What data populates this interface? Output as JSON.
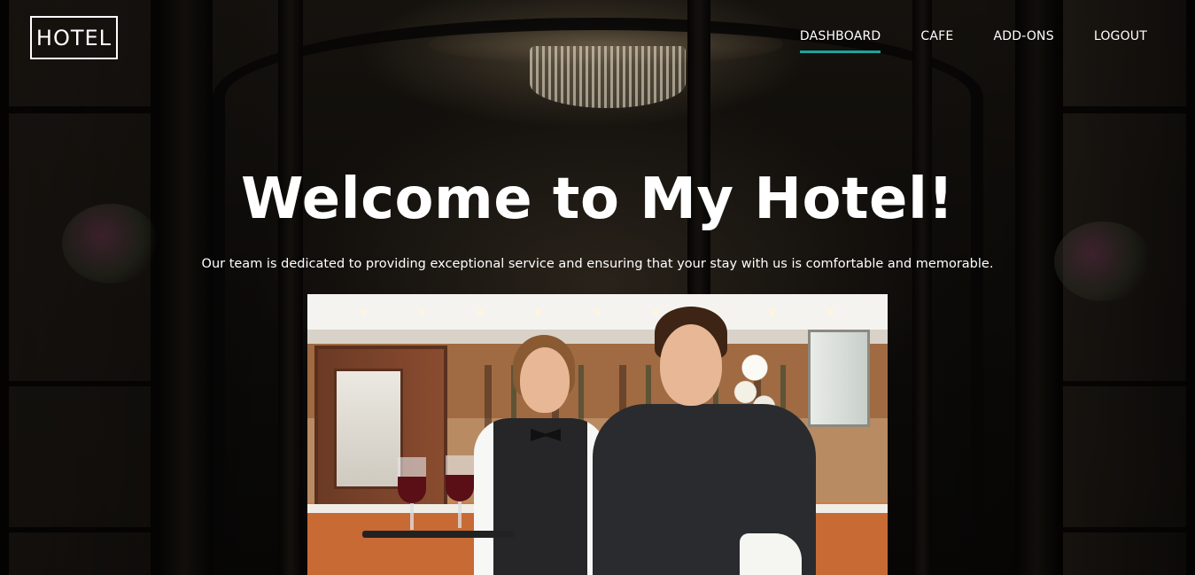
{
  "brand": {
    "logo_text": "HOTEL"
  },
  "nav": {
    "items": [
      {
        "label": "DASHBOARD",
        "active": true
      },
      {
        "label": "CAFE",
        "active": false
      },
      {
        "label": "ADD-ONS",
        "active": false
      },
      {
        "label": "LOGOUT",
        "active": false
      }
    ],
    "active_color": "#1fa39a"
  },
  "hero": {
    "title": "Welcome to My Hotel!",
    "subtitle": "Our team is dedicated to providing exceptional service and ensuring that your stay with us is comfortable and memorable."
  },
  "colors": {
    "text": "#ffffff",
    "accent": "#1fa39a",
    "background": "#0a0907"
  }
}
